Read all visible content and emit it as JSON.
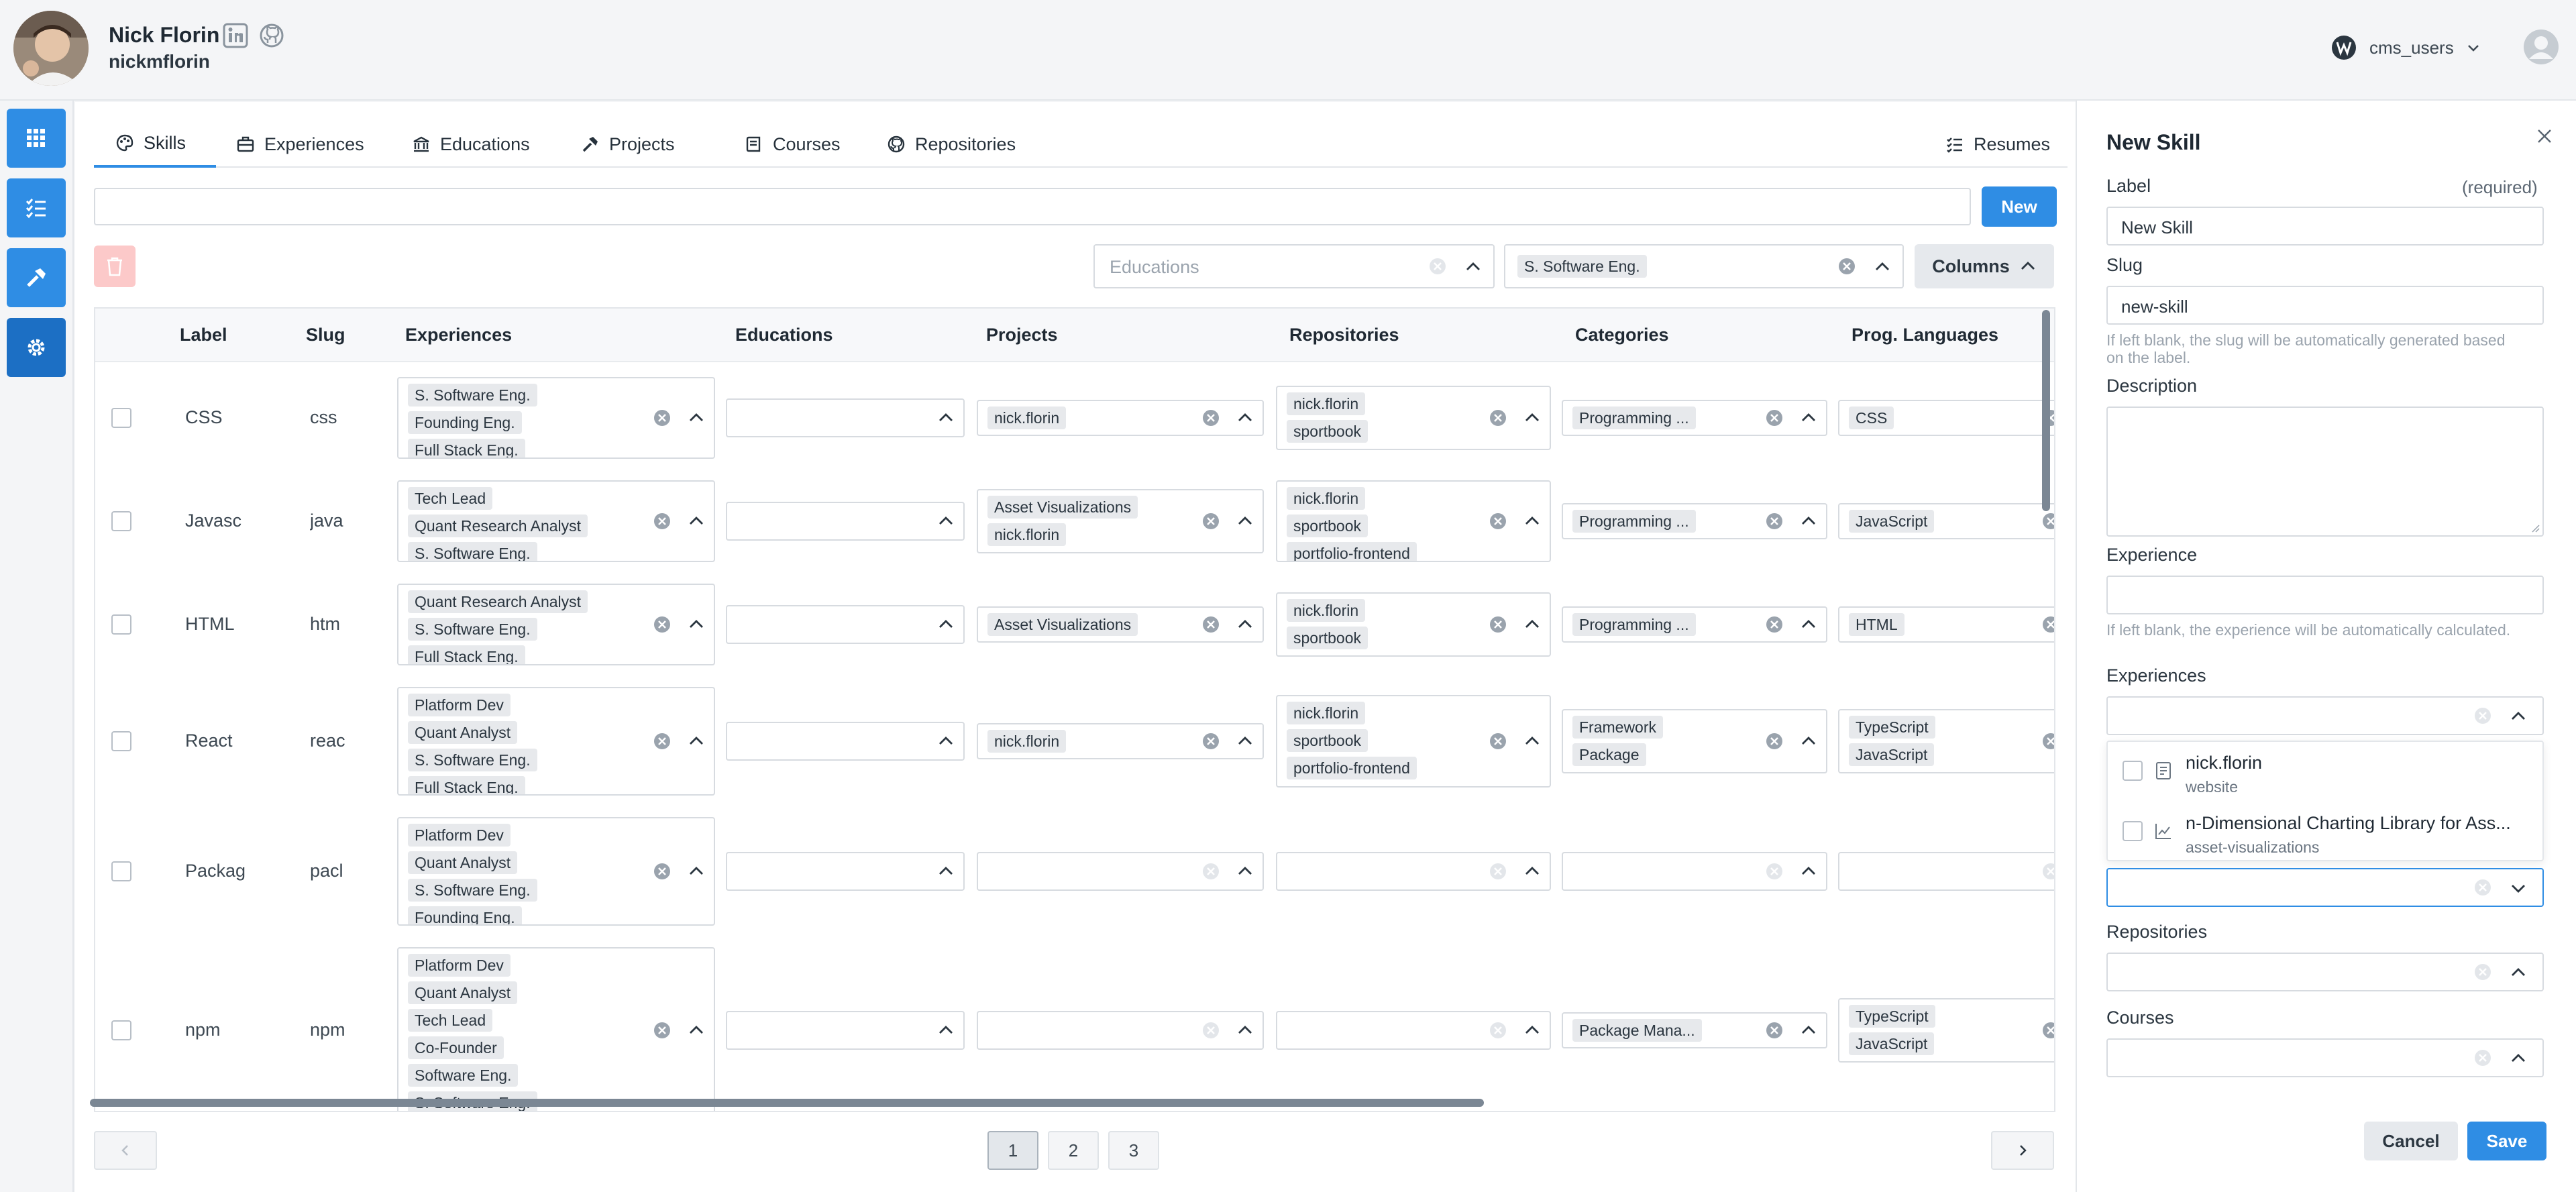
{
  "header": {
    "user_name": "Nick Florin",
    "user_handle": "nickmflorin",
    "workspace": "cms_users"
  },
  "tabs": [
    {
      "label": "Skills",
      "icon": "palette-icon"
    },
    {
      "label": "Experiences",
      "icon": "briefcase-icon"
    },
    {
      "label": "Educations",
      "icon": "building-columns-icon"
    },
    {
      "label": "Projects",
      "icon": "hammer-icon"
    },
    {
      "label": "Courses",
      "icon": "book-icon"
    },
    {
      "label": "Repositories",
      "icon": "github-icon"
    }
  ],
  "resumes_label": "Resumes",
  "toolbar": {
    "new_label": "New",
    "educations_placeholder": "Educations",
    "experience_filter_value": "S. Software Eng.",
    "columns_label": "Columns"
  },
  "table": {
    "columns": [
      "Label",
      "Slug",
      "Experiences",
      "Educations",
      "Projects",
      "Repositories",
      "Categories",
      "Prog. Languages"
    ],
    "rows": [
      {
        "label": "CSS",
        "slug": "css",
        "experiences": [
          "S. Software Eng.",
          "Founding Eng.",
          "Full Stack Eng."
        ],
        "projects": [
          "nick.florin"
        ],
        "repositories": [
          "nick.florin",
          "sportbook"
        ],
        "categories": [
          "Programming ..."
        ],
        "languages": [
          "CSS"
        ]
      },
      {
        "label": "Javasc",
        "slug": "java",
        "experiences": [
          "Tech Lead",
          "Quant Research Analyst",
          "S. Software Eng."
        ],
        "projects": [
          "Asset Visualizations",
          "nick.florin"
        ],
        "repositories": [
          "nick.florin",
          "sportbook",
          "portfolio-frontend"
        ],
        "categories": [
          "Programming ..."
        ],
        "languages": [
          "JavaScript"
        ]
      },
      {
        "label": "HTML",
        "slug": "htm",
        "experiences": [
          "Quant Research Analyst",
          "S. Software Eng.",
          "Full Stack Eng."
        ],
        "projects": [
          "Asset Visualizations"
        ],
        "repositories": [
          "nick.florin",
          "sportbook"
        ],
        "categories": [
          "Programming ..."
        ],
        "languages": [
          "HTML"
        ]
      },
      {
        "label": "React",
        "slug": "reac",
        "experiences": [
          "Platform Dev",
          "Quant Analyst",
          "S. Software Eng.",
          "Full Stack Eng."
        ],
        "projects": [
          "nick.florin"
        ],
        "repositories": [
          "nick.florin",
          "sportbook",
          "portfolio-frontend"
        ],
        "categories": [
          "Framework",
          "Package"
        ],
        "languages": [
          "TypeScript",
          "JavaScript"
        ]
      },
      {
        "label": "Packag",
        "slug": "pacl",
        "experiences": [
          "Platform Dev",
          "Quant Analyst",
          "S. Software Eng.",
          "Founding Eng."
        ],
        "projects": [],
        "repositories": [],
        "categories": [],
        "languages": []
      },
      {
        "label": "npm",
        "slug": "npm",
        "experiences": [
          "Platform Dev",
          "Quant Analyst",
          "Tech Lead",
          "Co-Founder",
          "Software Eng.",
          "S. Software Eng."
        ],
        "projects": [],
        "repositories": [],
        "categories": [
          "Package Mana..."
        ],
        "languages": [
          "TypeScript",
          "JavaScript"
        ]
      }
    ]
  },
  "pagination": {
    "pages": [
      "1",
      "2",
      "3"
    ],
    "current": "1"
  },
  "drawer": {
    "title": "New Skill",
    "label_field": "Label",
    "required": "(required)",
    "label_value": "New Skill",
    "slug_field": "Slug",
    "slug_value": "new-skill",
    "slug_help": "If left blank, the slug will be automatically generated based on the label.",
    "description_field": "Description",
    "experience_field": "Experience",
    "experience_help": "If left blank, the experience will be automatically calculated.",
    "experiences_field": "Experiences",
    "dropdown_items": [
      {
        "title": "nick.florin",
        "subtitle": "website",
        "icon": "document-icon"
      },
      {
        "title": "n-Dimensional Charting Library for Ass...",
        "subtitle": "asset-visualizations",
        "icon": "chart-icon"
      }
    ],
    "repositories_field": "Repositories",
    "courses_field": "Courses",
    "cancel_label": "Cancel",
    "save_label": "Save"
  },
  "colors": {
    "primary": "#2f8de4",
    "rail_active": "#1c6fc4",
    "danger_light": "#fcc9c9"
  }
}
